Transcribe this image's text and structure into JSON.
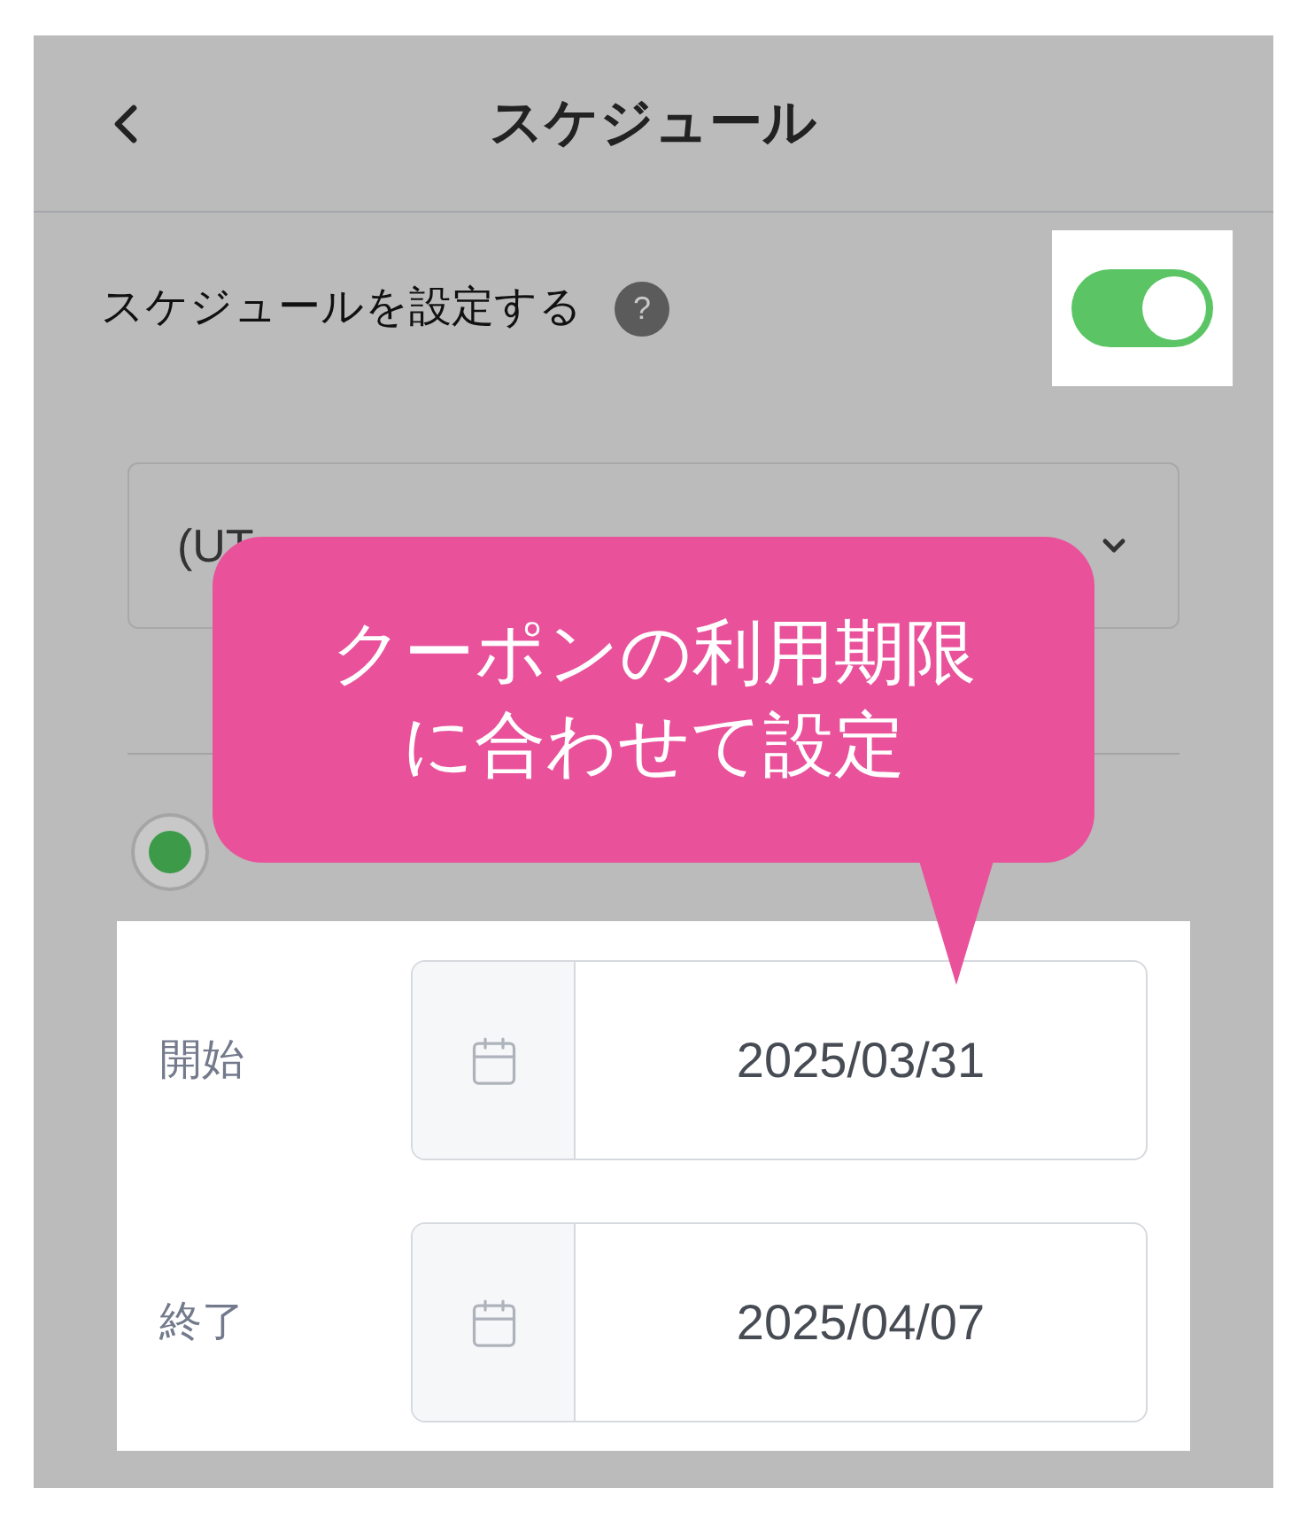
{
  "header": {
    "title": "スケジュール"
  },
  "schedule_toggle": {
    "label": "スケジュールを設定する",
    "help": "?",
    "on": true
  },
  "timezone": {
    "value": "(UT"
  },
  "period_option": {
    "selected": true
  },
  "dates": [
    {
      "label": "開始",
      "value": "2025/03/31"
    },
    {
      "label": "終了",
      "value": "2025/04/07"
    }
  ],
  "callout": {
    "lines": [
      "クーポンの利用期限",
      "に合わせて設定"
    ]
  }
}
